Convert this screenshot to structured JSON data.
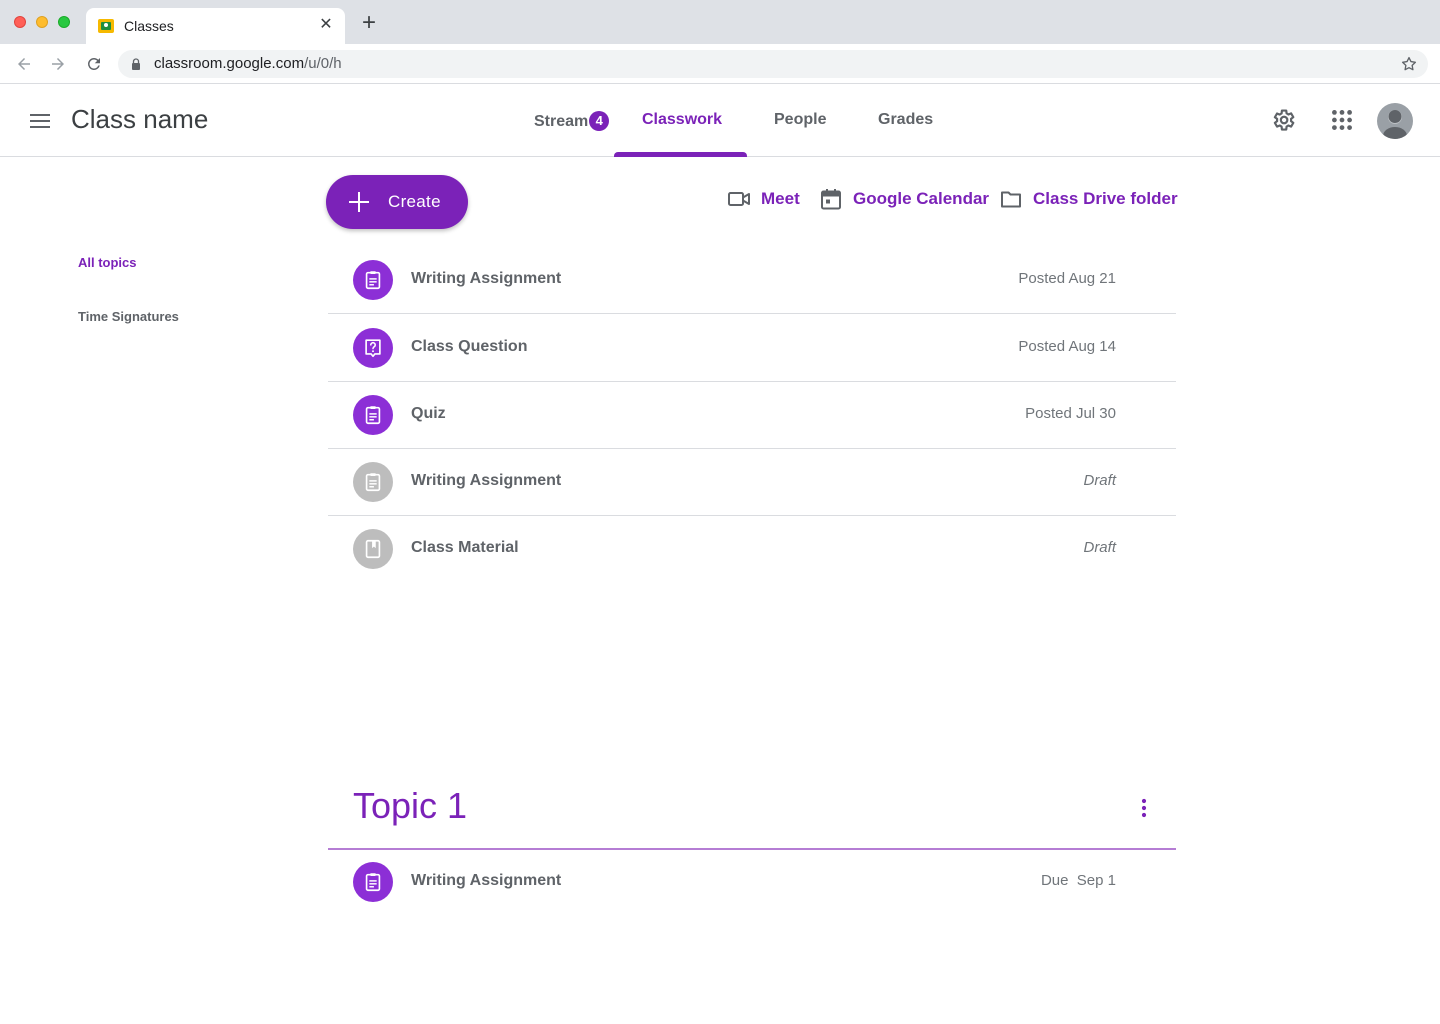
{
  "browser": {
    "tab_title": "Classes",
    "tab_close": "✕",
    "new_tab": "+",
    "url_host": "classroom.google.com",
    "url_path": "/u/0/h"
  },
  "header": {
    "class_name": "Class name",
    "tabs": [
      {
        "label": "Stream",
        "badge": "4"
      },
      {
        "label": "Classwork",
        "active": true
      },
      {
        "label": "People"
      },
      {
        "label": "Grades"
      }
    ]
  },
  "sidebar": {
    "topics": [
      {
        "label": "All topics",
        "active": true
      },
      {
        "label": "Time Signatures"
      }
    ]
  },
  "actions": {
    "create_label": "Create",
    "links": [
      {
        "label": "Meet",
        "icon": "video-camera-icon"
      },
      {
        "label": "Google Calendar",
        "icon": "calendar-icon"
      },
      {
        "label": "Class Drive folder",
        "icon": "folder-icon"
      }
    ]
  },
  "classwork": {
    "items": [
      {
        "title": "Writing Assignment",
        "meta": "Posted Aug 21",
        "icon": "assignment-icon",
        "state": "posted"
      },
      {
        "title": "Class Question",
        "meta": "Posted Aug 14",
        "icon": "question-icon",
        "state": "posted"
      },
      {
        "title": "Quiz",
        "meta": "Posted Jul 30",
        "icon": "assignment-icon",
        "state": "posted"
      },
      {
        "title": "Writing Assignment",
        "meta": "Draft",
        "icon": "assignment-icon",
        "state": "draft"
      },
      {
        "title": "Class Material",
        "meta": "Draft",
        "icon": "material-icon",
        "state": "draft"
      }
    ]
  },
  "topic_section": {
    "title": "Topic 1",
    "items": [
      {
        "title": "Writing Assignment",
        "meta": "Due  Sep 1",
        "icon": "assignment-icon"
      }
    ]
  },
  "colors": {
    "accent": "#7b22b8",
    "icon_purple": "#8c2fd6",
    "icon_draft": "#bdbdbd"
  }
}
